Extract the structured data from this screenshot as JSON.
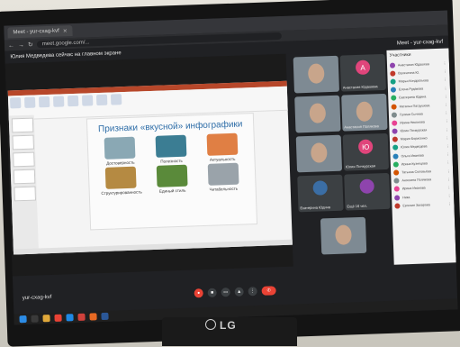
{
  "browser": {
    "tab_active": "Meet - yur-cxag-kvf",
    "url": "meet.google.com/...",
    "window_title": "Meet - yur-cxag-kvf"
  },
  "meet": {
    "presenter_note": "Юлия Медведева сейчас на главном экране",
    "meeting_code": "yur-cxag-kvf",
    "participants_title": "Участники"
  },
  "slide": {
    "title": "Признаки «вкусной» инфографики",
    "items": [
      {
        "label": "Достоверность",
        "color": "#8aa8b4"
      },
      {
        "label": "Полезность",
        "color": "#3b7d93"
      },
      {
        "label": "Актуальность",
        "color": "#e07f44"
      },
      {
        "label": "Структурированность",
        "color": "#b58a42"
      },
      {
        "label": "Единый стиль",
        "color": "#5a8a3a"
      },
      {
        "label": "Читабельность",
        "color": "#9aa3aa"
      }
    ]
  },
  "tiles": [
    {
      "name": "",
      "type": "video"
    },
    {
      "name": "Анастасия Юдашева",
      "type": "avatar",
      "letter": "А",
      "color": "#e0457b"
    },
    {
      "name": "",
      "type": "video"
    },
    {
      "name": "Анастасия Полякова",
      "type": "video"
    },
    {
      "name": "",
      "type": "video"
    },
    {
      "name": "Юлия Пичкурская",
      "type": "avatar",
      "letter": "Ю",
      "color": "#e0457b"
    },
    {
      "name": "Екатерина Юдина",
      "type": "avatar",
      "letter": "",
      "color": "#3b6ea5"
    },
    {
      "name": "Ещё 16 чел.",
      "type": "avatar",
      "letter": "",
      "color": "#8e44ad"
    },
    {
      "name": "",
      "type": "video"
    }
  ],
  "participants": [
    "Анастасия Юдашева",
    "Валентина Ю.",
    "Марья Кондратьева",
    "Елена Рудакова",
    "Екатерина Юдина",
    "Наталья Патрушева",
    "Галина Сычева",
    "Ирина Никонова",
    "Юлия Пичкурская",
    "Мария Борисенко",
    "Юлия Медведева",
    "Ольга Иванова",
    "Ирина Кузнецова",
    "Татьяна Соловьёва",
    "Ангелина Полякова",
    "Ирина Иванова",
    "Ника",
    "Евгения Захарова"
  ]
}
